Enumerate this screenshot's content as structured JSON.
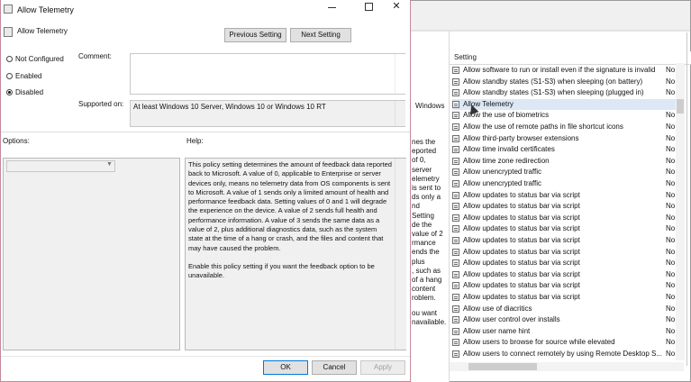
{
  "dialog": {
    "window_title": "Allow Telemetry",
    "header_title": "Allow Telemetry",
    "previous_setting": "Previous Setting",
    "next_setting": "Next Setting",
    "radios": [
      {
        "label": "Not Configured",
        "selected": false
      },
      {
        "label": "Enabled",
        "selected": false
      },
      {
        "label": "Disabled",
        "selected": true
      }
    ],
    "comment_label": "Comment:",
    "supported_label": "Supported on:",
    "supported_value": "At least Windows 10 Server, Windows 10 or Windows 10 RT",
    "options_label": "Options:",
    "help_label": "Help:",
    "help_paragraph_1": "This policy setting determines the amount of feedback data reported back to Microsoft. A value of 0, applicable to Enterprise or server devices only, means no telemetry data from OS components is sent to Microsoft. A value of 1 sends only a limited amount of health and performance feedback data. Setting values of 0 and 1 will degrade the experience on the device. A value of 2 sends full health and performance information. A value of 3 sends the same data as a value of 2, plus additional diagnostics data, such as the system state at the time of a hang or crash, and the files and content that may have caused the problem.",
    "help_paragraph_2": "Enable this policy setting if you want the feedback option to be unavailable.",
    "ok": "OK",
    "cancel": "Cancel",
    "apply": "Apply"
  },
  "background": {
    "setting_header": "Setting",
    "windows_word": "Windows",
    "snippets": [
      "nes the",
      "eported",
      "of 0,",
      "server",
      "elemetry",
      "is sent to",
      "ds only a",
      "nd",
      "Setting",
      "de the",
      "value of 2",
      "rmance",
      "ends the",
      "plus",
      ", such as",
      "of a hang",
      "content",
      "roblem.",
      "ou want",
      "navailable."
    ],
    "settings": [
      {
        "name": "Allow software to run or install even if the signature is invalid",
        "state": "No"
      },
      {
        "name": "Allow standby states (S1-S3) when sleeping (on battery)",
        "state": "No"
      },
      {
        "name": "Allow standby states (S1-S3) when sleeping (plugged in)",
        "state": "No"
      },
      {
        "name": "Allow Telemetry",
        "state": ""
      },
      {
        "name": "Allow the use of biometrics",
        "state": "No"
      },
      {
        "name": "Allow the use of remote paths in file shortcut icons",
        "state": "No"
      },
      {
        "name": "Allow third-party browser extensions",
        "state": "No"
      },
      {
        "name": "Allow time invalid certificates",
        "state": "No"
      },
      {
        "name": "Allow time zone redirection",
        "state": "No"
      },
      {
        "name": "Allow unencrypted traffic",
        "state": "No"
      },
      {
        "name": "Allow unencrypted traffic",
        "state": "No"
      },
      {
        "name": "Allow updates to status bar via script",
        "state": "No"
      },
      {
        "name": "Allow updates to status bar via script",
        "state": "No"
      },
      {
        "name": "Allow updates to status bar via script",
        "state": "No"
      },
      {
        "name": "Allow updates to status bar via script",
        "state": "No"
      },
      {
        "name": "Allow updates to status bar via script",
        "state": "No"
      },
      {
        "name": "Allow updates to status bar via script",
        "state": "No"
      },
      {
        "name": "Allow updates to status bar via script",
        "state": "No"
      },
      {
        "name": "Allow updates to status bar via script",
        "state": "No"
      },
      {
        "name": "Allow updates to status bar via script",
        "state": "No"
      },
      {
        "name": "Allow updates to status bar via script",
        "state": "No"
      },
      {
        "name": "Allow use of diacritics",
        "state": "No"
      },
      {
        "name": "Allow user control over installs",
        "state": "No"
      },
      {
        "name": "Allow user name hint",
        "state": "No"
      },
      {
        "name": "Allow users to browse for source while elevated",
        "state": "No"
      },
      {
        "name": "Allow users to connect remotely by using Remote Desktop S...",
        "state": "No"
      }
    ],
    "selected_setting": "Allow Telemetry"
  }
}
